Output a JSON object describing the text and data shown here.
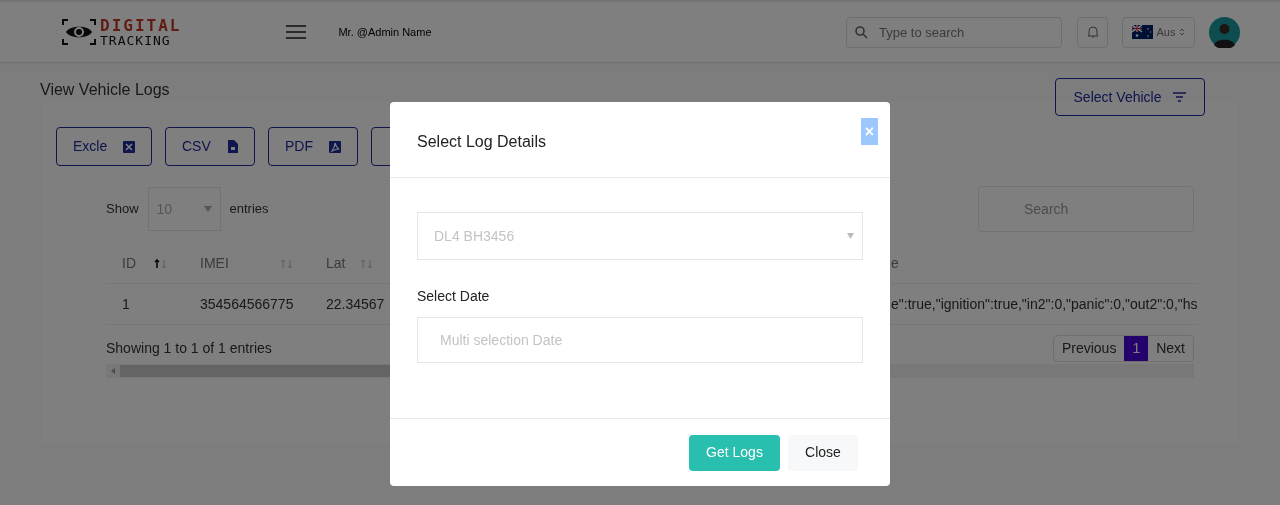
{
  "header": {
    "logo_top": "DIGITAL",
    "logo_bottom": "TRACKING",
    "user": "Mr. @Admin Name",
    "search": {
      "placeholder": "Type to search"
    },
    "language": "Aus"
  },
  "page": {
    "title": "View Vehicle Logs",
    "select_vehicle": "Select Vehicle"
  },
  "exports": [
    {
      "label": "Excle",
      "kind": "excel"
    },
    {
      "label": "CSV",
      "kind": "csv"
    },
    {
      "label": "PDF",
      "kind": "pdf"
    }
  ],
  "table": {
    "show": "Show",
    "page_size": "10",
    "entries": "entries",
    "search": {
      "placeholder": "Search"
    },
    "columns": [
      {
        "label": "ID",
        "sorted": true
      },
      {
        "label": "IMEI",
        "sorted": false
      },
      {
        "label": "Lat",
        "sorted": false
      },
      {
        "label": "e"
      }
    ],
    "rows": [
      [
        "1",
        "354564566775",
        "22.34567",
        "e\":true,\"ignition\":true,\"in2\":0,\"panic\":0,\"out2\":0,\"hs"
      ]
    ],
    "info": "Showing 1 to 1 of 1 entries",
    "pages": [
      {
        "label": "Previous",
        "selected": false
      },
      {
        "label": "1",
        "selected": true
      },
      {
        "label": "Next",
        "selected": false
      }
    ]
  },
  "modal": {
    "title": "Select Log Details",
    "close_icon": "×",
    "vehicle": "DL4 BH3456",
    "date_label": "Select Date",
    "date": {
      "placeholder": "Multi selection Date"
    },
    "buttons": [
      {
        "label": "Get Logs",
        "kind": "primary"
      },
      {
        "label": "Close",
        "kind": "secondary"
      }
    ]
  }
}
